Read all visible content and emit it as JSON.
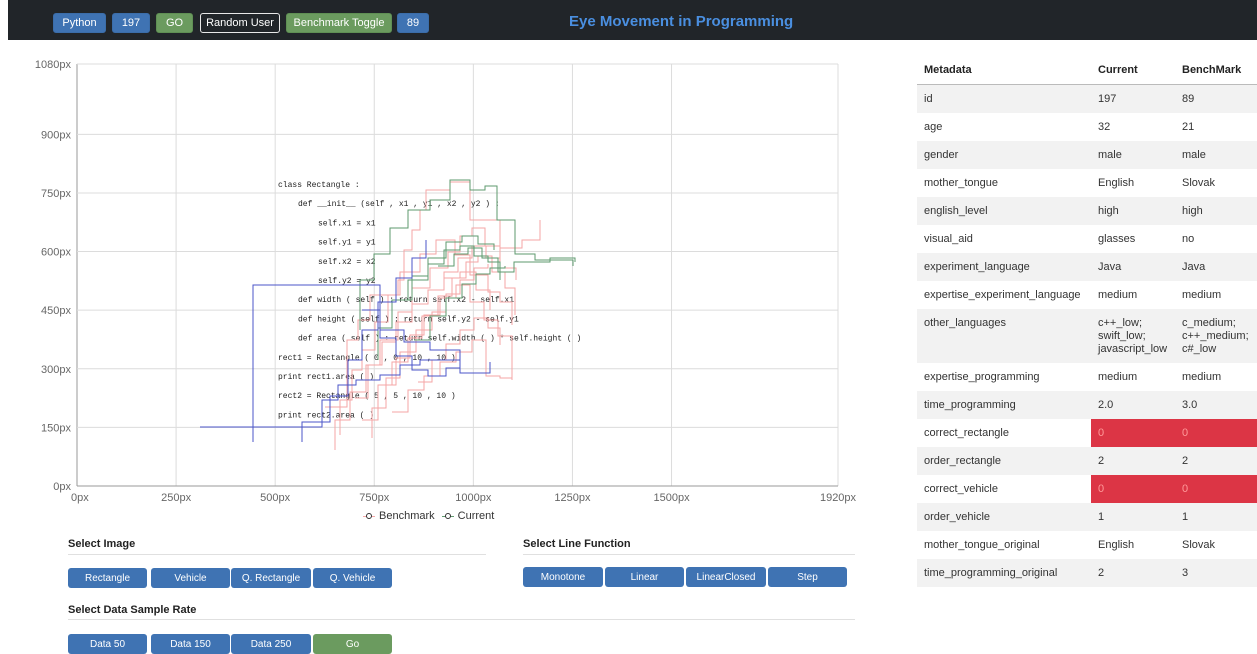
{
  "header": {
    "title": "Eye Movement in Programming",
    "buttons": [
      "Python",
      "197",
      "GO",
      "Random User",
      "Benchmark Toggle",
      "89"
    ]
  },
  "chart": {
    "x_ticks": [
      "0px",
      "250px",
      "500px",
      "750px",
      "1000px",
      "1250px",
      "1500px",
      "1920px"
    ],
    "y_ticks": [
      "0px",
      "150px",
      "300px",
      "450px",
      "600px",
      "750px",
      "900px",
      "1080px"
    ],
    "legend": [
      "Benchmark",
      "Current"
    ],
    "code_lines": [
      "class Rectangle :",
      "def __init__ (self , x1 , y1 , x2 , y2 ) :",
      "self.x1 = x1",
      "self.y1 = y1",
      "self.x2 = x2",
      "self.y2 = y2",
      "def width ( self ) : return self.x2 - self.x1",
      "def height ( self ) : return self.y2 - self.y1",
      "def area ( self ) : return self.width ( ) * self.height ( )",
      "rect1 = Rectangle ( 0 , 0 , 10 , 10 )",
      "print rect1.area ( )",
      "rect2 = Rectangle ( 5 , 5 , 10 , 10 )",
      "print rect2.area ( )"
    ]
  },
  "controls": {
    "select_image": "Select Image",
    "image_buttons": [
      "Rectangle",
      "Vehicle",
      "Q. Rectangle",
      "Q. Vehicle"
    ],
    "select_line": "Select Line Function",
    "line_buttons": [
      "Monotone",
      "Linear",
      "LinearClosed",
      "Step"
    ],
    "select_rate": "Select Data Sample Rate",
    "rate_buttons": [
      "Data 50",
      "Data 150",
      "Data 250",
      "Go"
    ]
  },
  "table": {
    "headers": [
      "Metadata",
      "Current",
      "BenchMark"
    ],
    "rows": [
      [
        "id",
        "197",
        "89"
      ],
      [
        "age",
        "32",
        "21"
      ],
      [
        "gender",
        "male",
        "male"
      ],
      [
        "mother_tongue",
        "English",
        "Slovak"
      ],
      [
        "english_level",
        "high",
        "high"
      ],
      [
        "visual_aid",
        "glasses",
        "no"
      ],
      [
        "experiment_language",
        "Java",
        "Java"
      ],
      [
        "expertise_experiment_language",
        "medium",
        "medium"
      ],
      [
        "other_languages",
        "c++_low;\nswift_low;\njavascript_low",
        "c_medium;\nc++_medium;\nc#_low"
      ],
      [
        "expertise_programming",
        "medium",
        "medium"
      ],
      [
        "time_programming",
        "2.0",
        "3.0"
      ],
      [
        "correct_rectangle",
        "0",
        "0"
      ],
      [
        "order_rectangle",
        "2",
        "2"
      ],
      [
        "correct_vehicle",
        "0",
        "0"
      ],
      [
        "order_vehicle",
        "1",
        "1"
      ],
      [
        "mother_tongue_original",
        "English",
        "Slovak"
      ],
      [
        "time_programming_original",
        "2",
        "3"
      ]
    ]
  },
  "colors": {
    "blue_button": "#3f73b3",
    "green_button": "#6b9b5f",
    "benchmark_line": "#f4a6a6",
    "current_line": "#5e9a6e",
    "extra_line": "#4b55c8",
    "bad_cell": "#dc3545"
  }
}
